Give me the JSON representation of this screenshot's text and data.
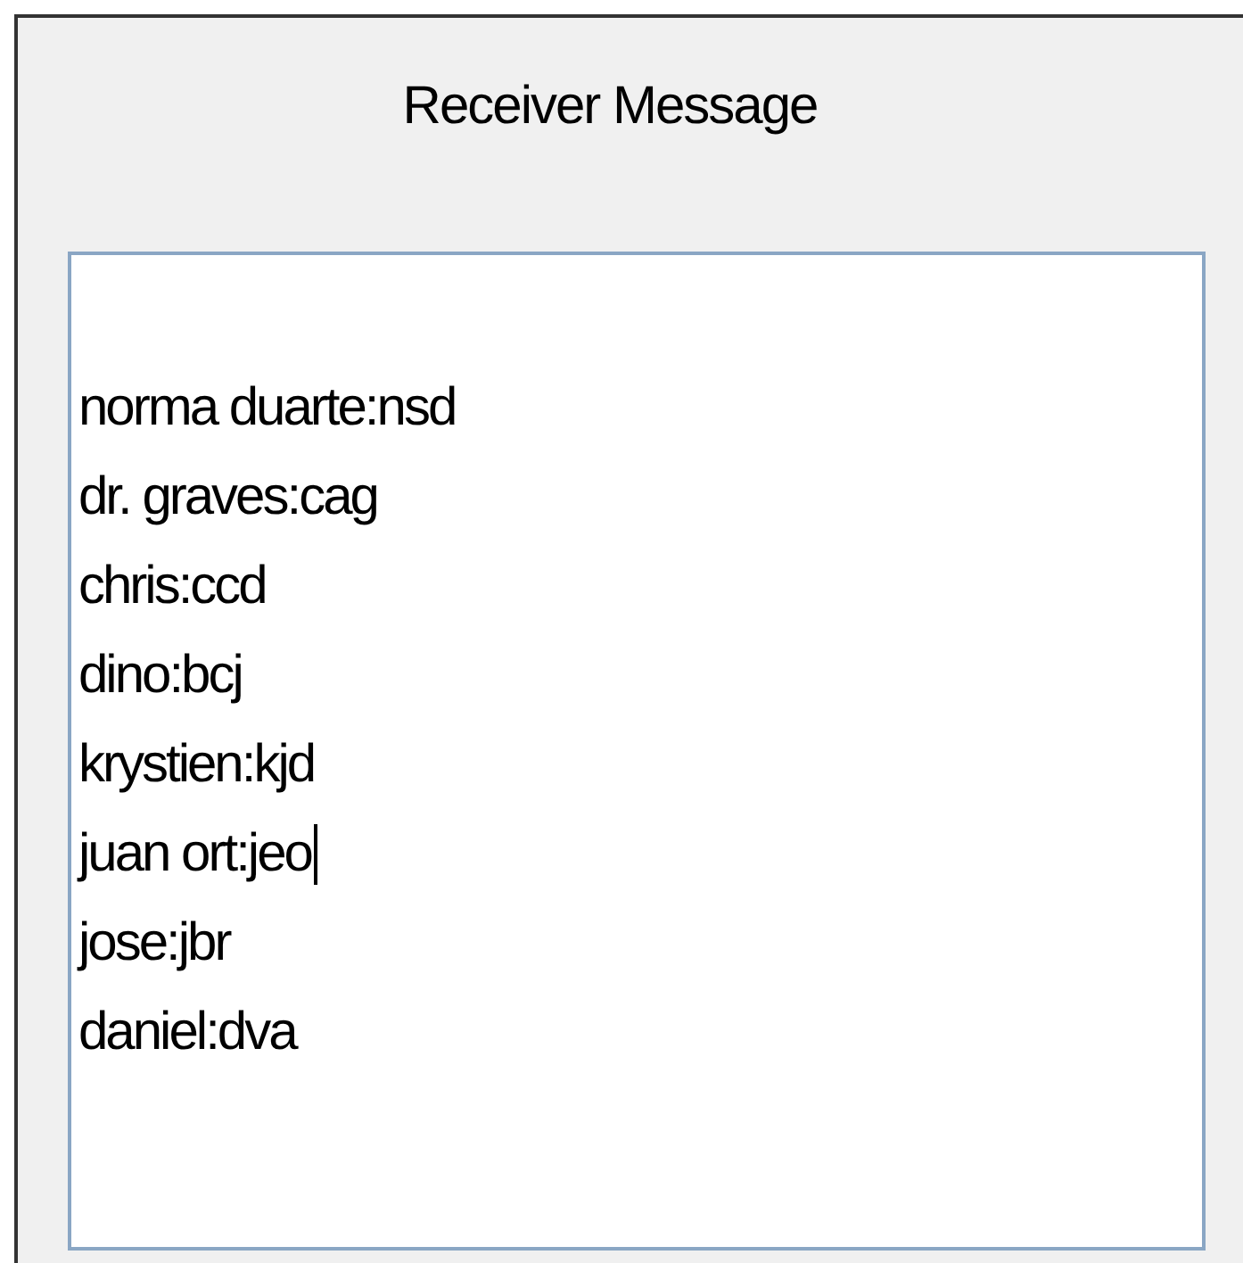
{
  "window": {
    "title": "Receiver Message"
  },
  "message": {
    "lines": [
      {
        "text": "norma duarte:nsd",
        "caret": false
      },
      {
        "text": "dr. graves:cag",
        "caret": false
      },
      {
        "text": "chris:ccd",
        "caret": false
      },
      {
        "text": "dino:bcj",
        "caret": false
      },
      {
        "text": "krystien:kjd",
        "caret": false
      },
      {
        "text": "juan ort:jeo",
        "caret": true
      },
      {
        "text": "jose:jbr",
        "caret": false
      },
      {
        "text": "daniel:dva",
        "caret": false
      }
    ]
  }
}
